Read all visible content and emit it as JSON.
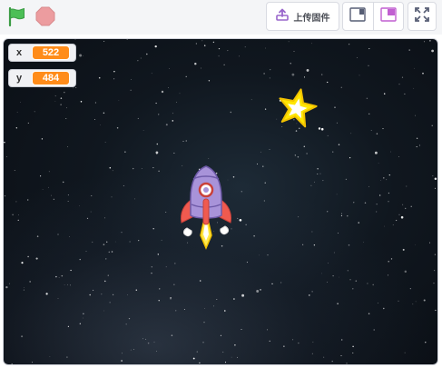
{
  "toolbar": {
    "upload_label": "上传固件"
  },
  "monitors": [
    {
      "label": "x",
      "value": "522"
    },
    {
      "label": "y",
      "value": "484"
    }
  ],
  "colors": {
    "accent": "#ff8c1a",
    "flag": "#4cbf56",
    "stop": "#ec9c9f",
    "upload_icon": "#9966cc",
    "layout_active": "#c15fd1"
  },
  "icons": {
    "flag": "green-flag-icon",
    "stop": "stop-icon",
    "upload": "upload-icon",
    "small_stage": "small-stage-layout-icon",
    "large_stage": "large-stage-layout-icon",
    "fullscreen": "fullscreen-icon"
  }
}
